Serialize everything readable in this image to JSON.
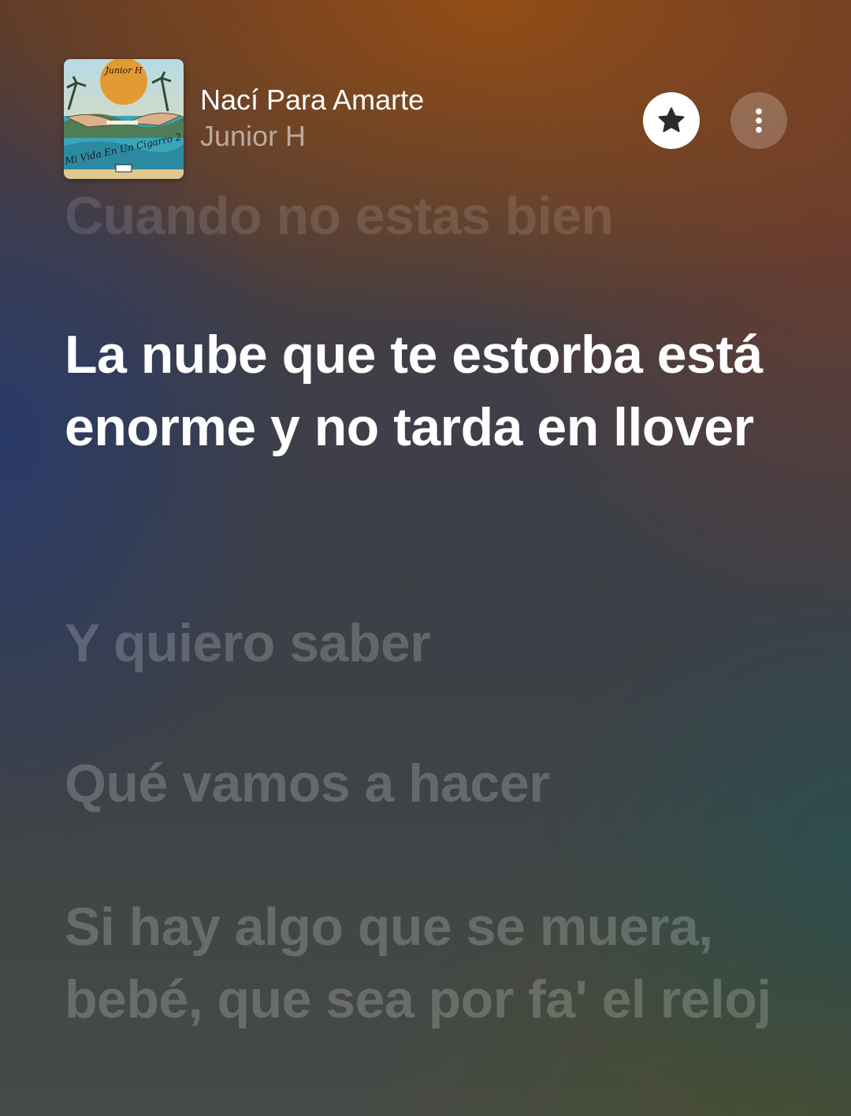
{
  "now_playing": {
    "title": "Nací Para Amarte",
    "artist": "Junior H",
    "artwork_icon": "album-artwork",
    "favorite_icon": "star-icon",
    "more_icon": "more-vertical-icon"
  },
  "lyrics": {
    "previous": "Cuando no estas bien",
    "current": "La nube que te estorba está enorme y no tarda en llover",
    "upcoming": [
      "Y quiero saber",
      "Qué vamos a hacer",
      "Si hay algo que se muera, bebé, que sea por fa' el reloj"
    ]
  },
  "colors": {
    "active_lyric": "#ffffff",
    "background_top": "#8a4a1c",
    "background_mid": "#3e3f48"
  }
}
